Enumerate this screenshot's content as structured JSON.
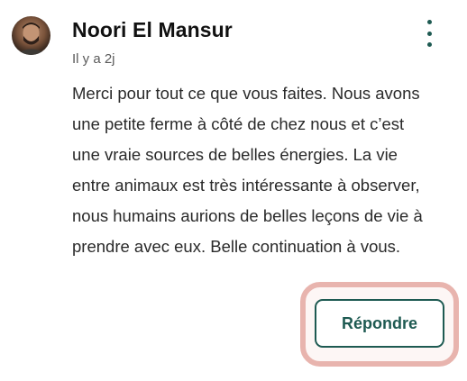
{
  "comment": {
    "author_name": "Noori El Mansur",
    "time_ago": "Il y a 2j",
    "text": "Merci pour tout ce que vous faites. Nous avons une petite ferme à côté de chez nous et c’est une vraie sources de belles énergies. La vie entre animaux est très intéressante à observer, nous humains aurions de belles leçons de vie à prendre avec eux. Belle continuation à vous.",
    "reply_label": "Répondre",
    "menu_icon": "more-vertical-icon"
  },
  "colors": {
    "accent": "#1e5a52",
    "highlight_border": "#e8b4ae"
  }
}
